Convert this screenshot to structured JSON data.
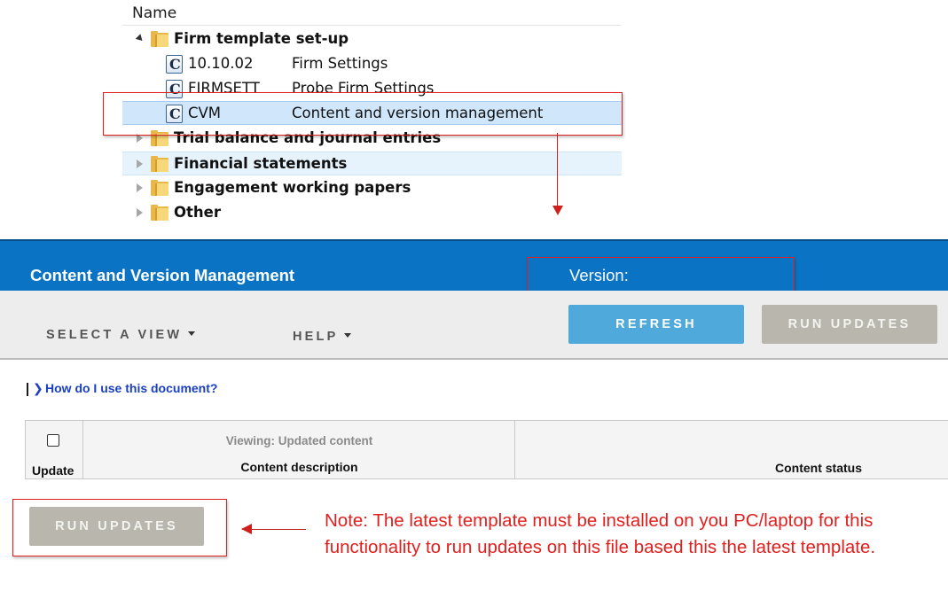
{
  "tree": {
    "header": "Name",
    "rows": [
      {
        "type": "folder",
        "label": "Firm template set-up",
        "expanded": true
      },
      {
        "type": "doc",
        "code": "10.10.02",
        "desc": "Firm Settings"
      },
      {
        "type": "doc",
        "code": "FIRMSETT",
        "desc": "Probe Firm Settings"
      },
      {
        "type": "doc",
        "code": "CVM",
        "desc": "Content and version management",
        "selected": true
      },
      {
        "type": "folder",
        "label": "Trial balance and journal entries",
        "expanded": false
      },
      {
        "type": "folder",
        "label": "Financial statements",
        "expanded": false
      },
      {
        "type": "folder",
        "label": "Engagement working papers",
        "expanded": false
      },
      {
        "type": "folder",
        "label": "Other",
        "expanded": false
      }
    ],
    "doc_icon_glyph": "C"
  },
  "app": {
    "title": "Content and Version Management",
    "version_label": "Version:",
    "menus": {
      "select_view": "SELECT A VIEW",
      "help": "HELP"
    },
    "buttons": {
      "refresh": "REFRESH",
      "run_updates": "RUN UPDATES"
    },
    "help_link": "How do I use this document?",
    "table": {
      "update_header": "Update",
      "viewing_label": "Viewing: Updated content",
      "desc_header": "Content description",
      "status_header": "Content status"
    },
    "bottom_button": "RUN UPDATES"
  },
  "annotation": {
    "note": "Note: The latest template must be installed on you PC/laptop for this functionality to run updates on this file based this the latest template.",
    "color": "#e0201e"
  },
  "colors": {
    "header_blue": "#0a73c4",
    "refresh_blue": "#4fa9db",
    "disabled_gray": "#b9b7ad",
    "selection": "#cfe6fb"
  }
}
